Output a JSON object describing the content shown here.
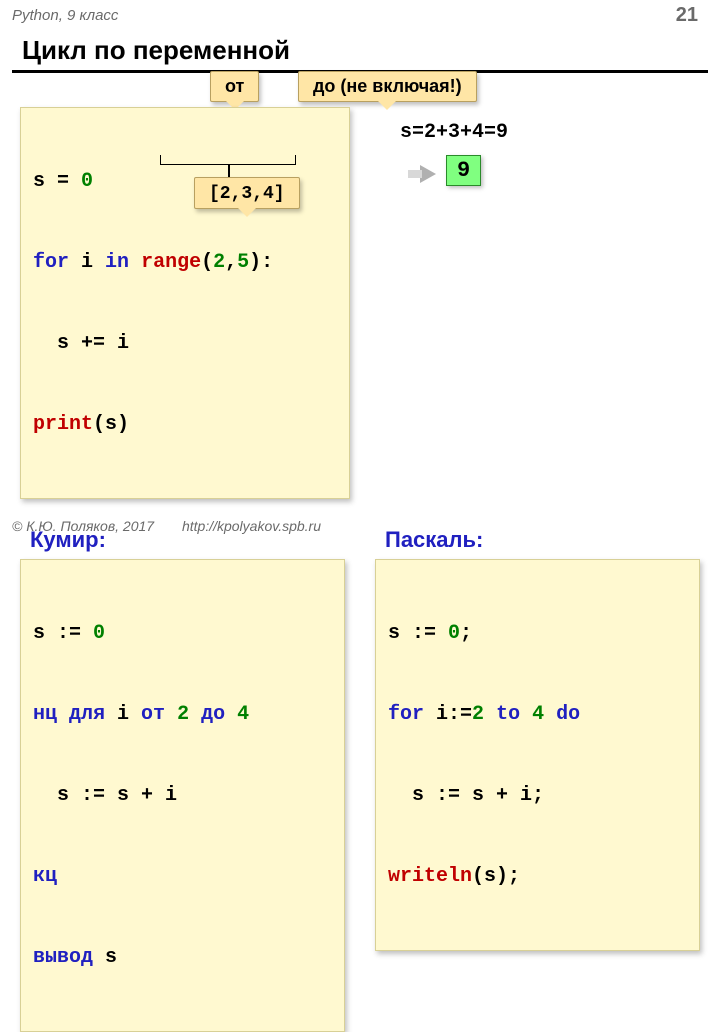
{
  "header": {
    "left": "Python, 9 класс",
    "page": "21"
  },
  "title": "Цикл по переменной",
  "tags": {
    "from": "от",
    "to": "до (не включая!)",
    "range_list": "[2,3,4]"
  },
  "python": {
    "l1a": "s = ",
    "l1b": "0",
    "l2a": "for",
    "l2b": " i ",
    "l2c": "in",
    "l2d": " ",
    "l2e": "range",
    "l2f": "(",
    "l2g": "2",
    "l2h": ",",
    "l2i": "5",
    "l2j": "):",
    "l3": "  s += i",
    "l4a": "print",
    "l4b": "(s)"
  },
  "calc": {
    "expr": "s=2+3+4=9",
    "result": "9"
  },
  "kumir": {
    "label": "Кумир:",
    "l1a": "s := ",
    "l1b": "0",
    "l2a": "нц для",
    "l2b": " i ",
    "l2c": "от",
    "l2d": " ",
    "l2e": "2",
    "l2f": " ",
    "l2g": "до",
    "l2h": " ",
    "l2i": "4",
    "l3": "  s := s + i",
    "l4": "кц",
    "l5a": "вывод",
    "l5b": " s"
  },
  "pascal": {
    "label": "Паскаль:",
    "l1a": "s := ",
    "l1b": "0",
    "l1c": ";",
    "l2a": "for",
    "l2b": " i:=",
    "l2c": "2",
    "l2d": " ",
    "l2e": "to",
    "l2f": " ",
    "l2g": "4",
    "l2h": " ",
    "l2i": "do",
    "l3": "  s := s + i;",
    "l4a": "writeln",
    "l4b": "(s);"
  },
  "footer": {
    "copyright": "© К.Ю. Поляков, 2017",
    "url": "http://kpolyakov.spb.ru"
  }
}
